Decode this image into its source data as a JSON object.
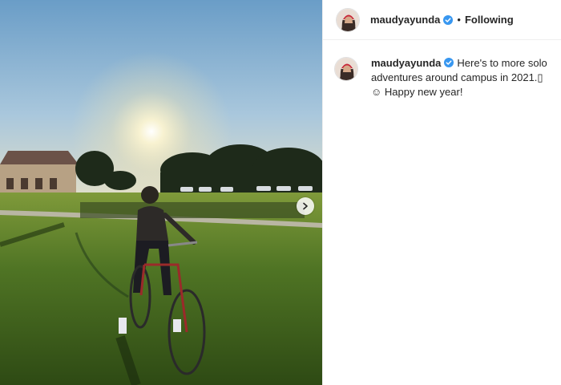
{
  "post": {
    "username": "maudyayunda",
    "follow_status": "Following",
    "separator": "•",
    "caption": "Here's to more solo adventures around campus in 2021.▯",
    "caption_line2": "Happy new year!",
    "caption_emoji_1": "▯",
    "caption_emoji_2": "☺"
  },
  "icons": {
    "verified": "verified-badge-icon",
    "next": "chevron-right-icon"
  },
  "colors": {
    "verified_blue": "#3897f0",
    "text": "#262626",
    "border": "#efefef"
  }
}
